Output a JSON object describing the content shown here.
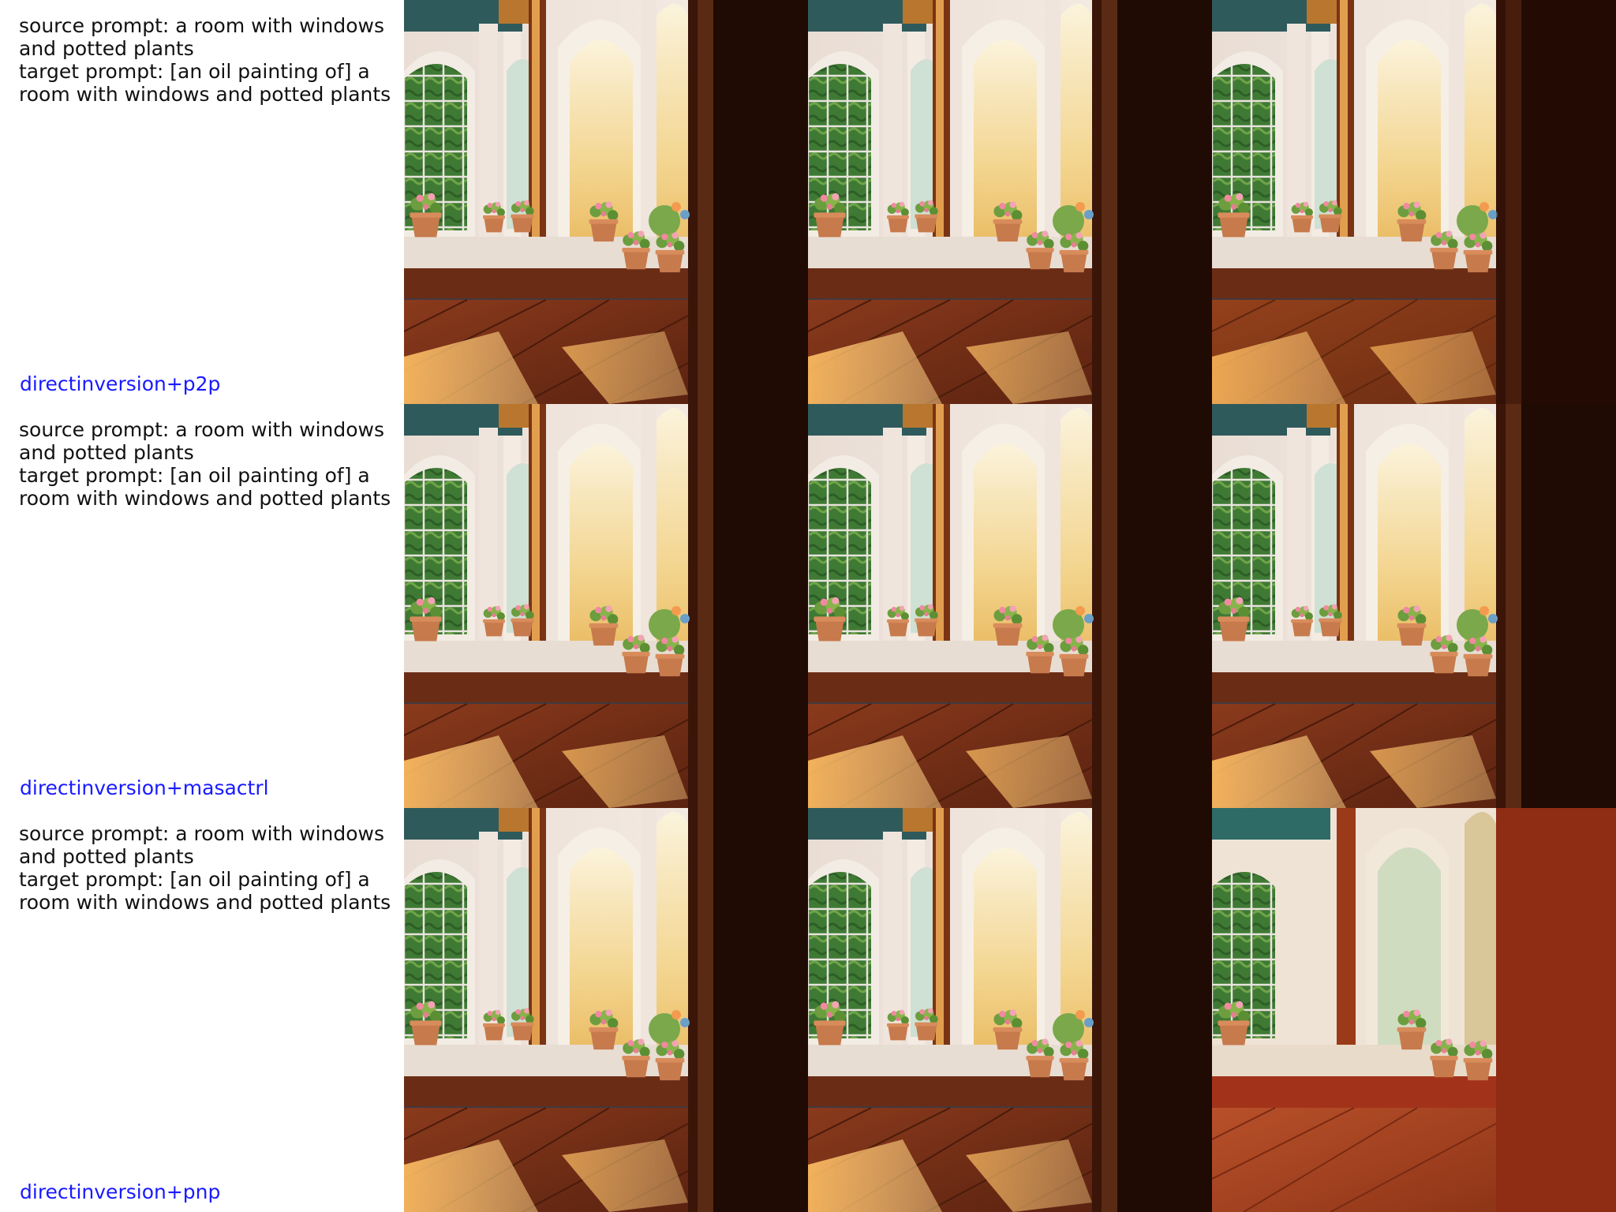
{
  "rows": [
    {
      "source_prompt": "source prompt: a room with windows\nand potted plants",
      "target_prompt": "target prompt: [an oil painting of] a\nroom with windows and potted plants",
      "method": "directinversion+p2p",
      "color": "#1a1aff"
    },
    {
      "source_prompt": "source prompt: a room with windows\nand potted plants",
      "target_prompt": "target prompt: [an oil painting of] a\nroom with windows and potted plants",
      "method": "directinversion+masactrl",
      "color": "#1a1aff"
    },
    {
      "source_prompt": "source prompt: a room with windows\nand potted plants",
      "target_prompt": "target prompt: [an oil painting of] a\nroom with windows and potted plants",
      "method": "directinversion+pnp",
      "color": "#1a1aff"
    }
  ]
}
